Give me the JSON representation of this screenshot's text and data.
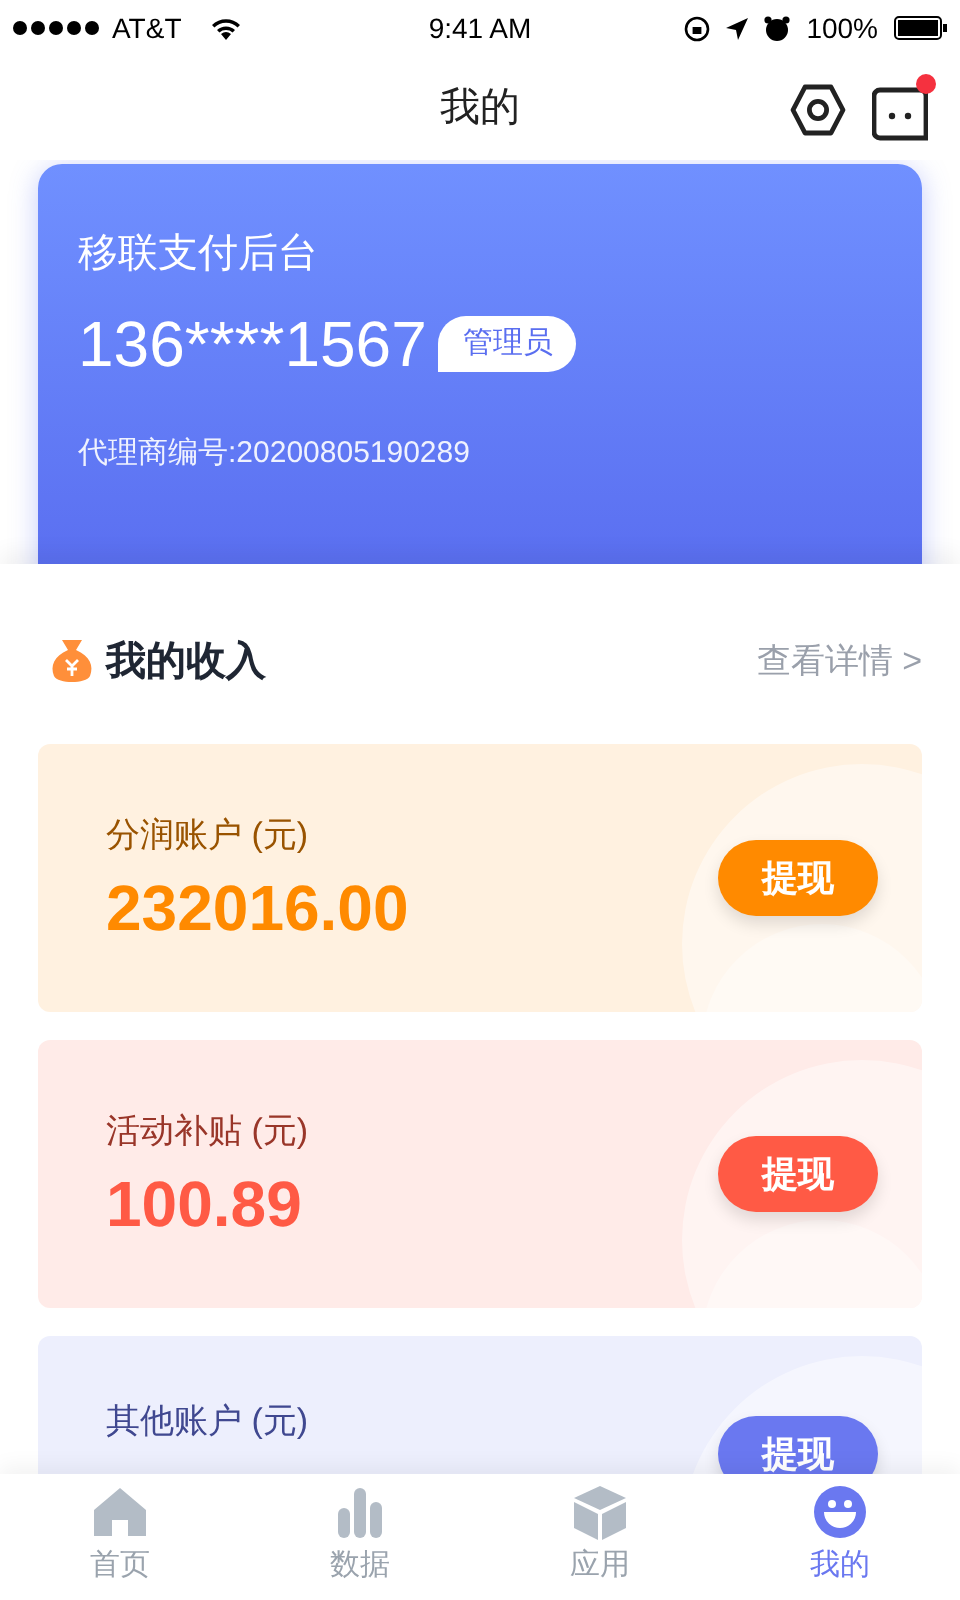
{
  "status_bar": {
    "carrier": "AT&T",
    "time": "9:41 AM",
    "battery": "100%"
  },
  "nav": {
    "title": "我的",
    "message_badge": true
  },
  "profile": {
    "app_name": "移联支付后台",
    "phone": "136****1567",
    "role": "管理员",
    "agent_no": "代理商编号:20200805190289"
  },
  "income": {
    "title": "我的收入",
    "more": "查看详情 >"
  },
  "accounts": [
    {
      "label": "分润账户 (元)",
      "amount": "232016.00",
      "button": "提现",
      "color": "#ff8a00"
    },
    {
      "label": "活动补贴 (元)",
      "amount": "100.89",
      "button": "提现",
      "color": "#ff5a45"
    },
    {
      "label": "其他账户 (元)",
      "button": "提现",
      "color": "#6a78f0"
    }
  ],
  "tabs": [
    {
      "label": "首页",
      "selected": false
    },
    {
      "label": "数据",
      "selected": false
    },
    {
      "label": "应用",
      "selected": false
    },
    {
      "label": "我的",
      "selected": true
    }
  ]
}
